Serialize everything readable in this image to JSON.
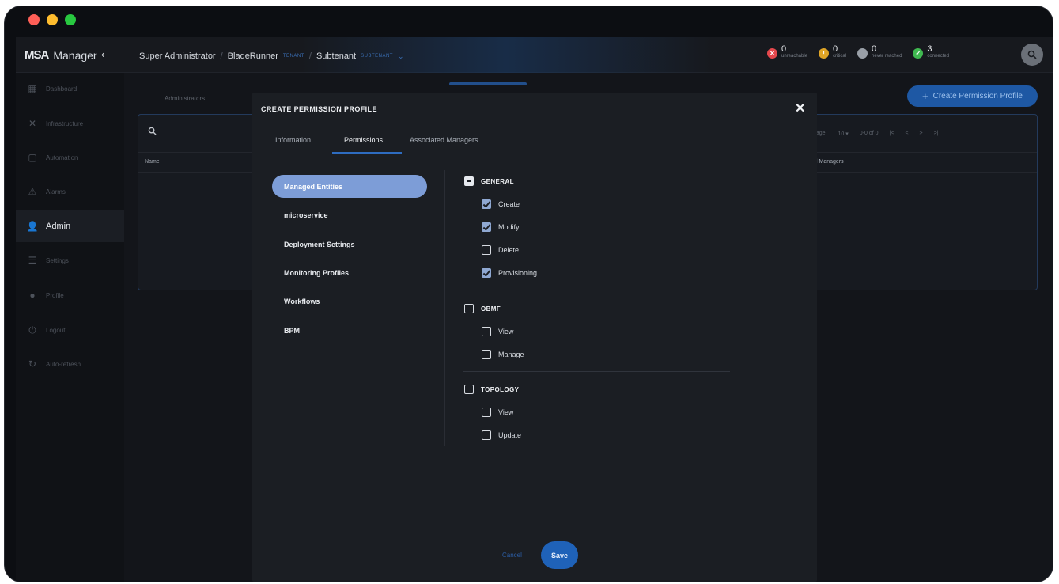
{
  "window": {
    "traffic_lights": [
      "#fe5f57",
      "#febc2e",
      "#28c840"
    ]
  },
  "topbar": {
    "logo_mark": "MSA",
    "app_name": "Manager",
    "collapse_icon": "chevron-left-icon",
    "breadcrumb": {
      "admin": "Super Administrator",
      "tenant": "BladeRunner",
      "tenant_tag": "TENANT",
      "subtenant": "Subtenant",
      "subtenant_tag": "SUBTENANT",
      "subtenant_caret": "⌄"
    },
    "statuses": [
      {
        "count": "0",
        "label": "unreachable",
        "color": "#e5484d",
        "glyph": "✕"
      },
      {
        "count": "0",
        "label": "critical",
        "color": "#e0a526",
        "glyph": "!"
      },
      {
        "count": "0",
        "label": "never reached",
        "color": "#9aa0a8",
        "glyph": ""
      },
      {
        "count": "3",
        "label": "connected",
        "color": "#3fb950",
        "glyph": "✓"
      }
    ],
    "search_icon": "🔍"
  },
  "sidebar": {
    "items": [
      {
        "label": "Dashboard",
        "icon": "▦"
      },
      {
        "label": "Infrastructure",
        "icon": "✕"
      },
      {
        "label": "Automation",
        "icon": "▢"
      },
      {
        "label": "Alarms",
        "icon": "⚠"
      },
      {
        "label": "Admin",
        "icon": "👤"
      },
      {
        "label": "Settings",
        "icon": "☰"
      },
      {
        "label": "Profile",
        "icon": "●"
      },
      {
        "label": "Logout",
        "icon": "⏻"
      },
      {
        "label": "Auto-refresh",
        "icon": "↻"
      }
    ]
  },
  "background": {
    "tab_administrators": "Administrators",
    "create_button": "Create Permission Profile",
    "table": {
      "col_name": "Name",
      "col_managers": "l Managers",
      "pager": {
        "rows_label": "page:",
        "rows_value": "10 ▾",
        "range": "0-0 of 0",
        "first": "|<",
        "prev": "<",
        "next": ">",
        "last": ">|"
      }
    }
  },
  "modal": {
    "title": "CREATE PERMISSION PROFILE",
    "close": "✕",
    "tabs": [
      "Information",
      "Permissions",
      "Associated Managers"
    ],
    "active_tab": "Permissions",
    "categories": [
      "Managed Entities",
      "microservice",
      "Deployment Settings",
      "Monitoring Profiles",
      "Workflows",
      "BPM"
    ],
    "active_category": "Managed Entities",
    "groups": [
      {
        "title": "GENERAL",
        "state": "mixed",
        "items": [
          {
            "label": "Create",
            "checked": true
          },
          {
            "label": "Modify",
            "checked": true
          },
          {
            "label": "Delete",
            "checked": false
          },
          {
            "label": "Provisioning",
            "checked": true
          }
        ]
      },
      {
        "title": "OBMF",
        "state": "unchecked",
        "items": [
          {
            "label": "View",
            "checked": false
          },
          {
            "label": "Manage",
            "checked": false
          }
        ]
      },
      {
        "title": "TOPOLOGY",
        "state": "unchecked",
        "items": [
          {
            "label": "View",
            "checked": false
          },
          {
            "label": "Update",
            "checked": false
          }
        ]
      }
    ],
    "cancel": "Cancel",
    "save": "Save"
  }
}
